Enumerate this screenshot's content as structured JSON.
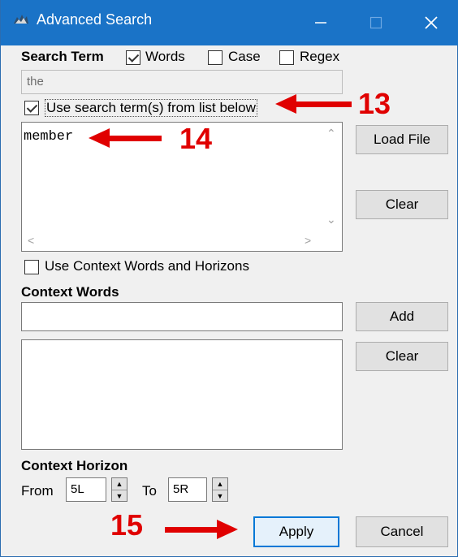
{
  "window": {
    "title": "Advanced Search"
  },
  "search_term": {
    "label": "Search Term",
    "words_label": "Words",
    "case_label": "Case",
    "regex_label": "Regex",
    "value": "the",
    "use_list_label": "Use search term(s) from list below"
  },
  "term_list": {
    "text": "member",
    "load_file_label": "Load File",
    "clear_label": "Clear"
  },
  "context": {
    "use_label": "Use Context Words and Horizons",
    "words_heading": "Context Words",
    "add_label": "Add",
    "clear_label": "Clear"
  },
  "horizon": {
    "heading": "Context Horizon",
    "from_label": "From",
    "from_value": "5L",
    "to_label": "To",
    "to_value": "5R"
  },
  "footer": {
    "apply_label": "Apply",
    "cancel_label": "Cancel"
  },
  "annotations": {
    "a13": "13",
    "a14": "14",
    "a15": "15"
  }
}
